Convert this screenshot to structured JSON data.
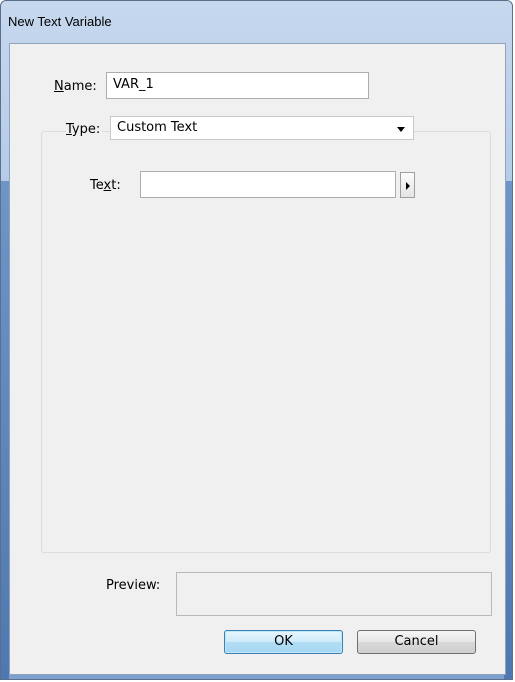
{
  "window": {
    "title": "New Text Variable"
  },
  "name_field": {
    "label": "Name:",
    "label_accel": "N",
    "label_rest": "ame:",
    "value": "VAR_1"
  },
  "type_field": {
    "label_accel": "T",
    "label_rest": "ype:",
    "selected": "Custom Text"
  },
  "text_field": {
    "label_pre": "Te",
    "label_accel": "x",
    "label_post": "t:",
    "value": ""
  },
  "preview": {
    "label": "Preview:",
    "value": ""
  },
  "buttons": {
    "ok": "OK",
    "cancel": "Cancel"
  },
  "icons": {
    "menu": "right-triangle",
    "dropdown": "chevron-down"
  }
}
